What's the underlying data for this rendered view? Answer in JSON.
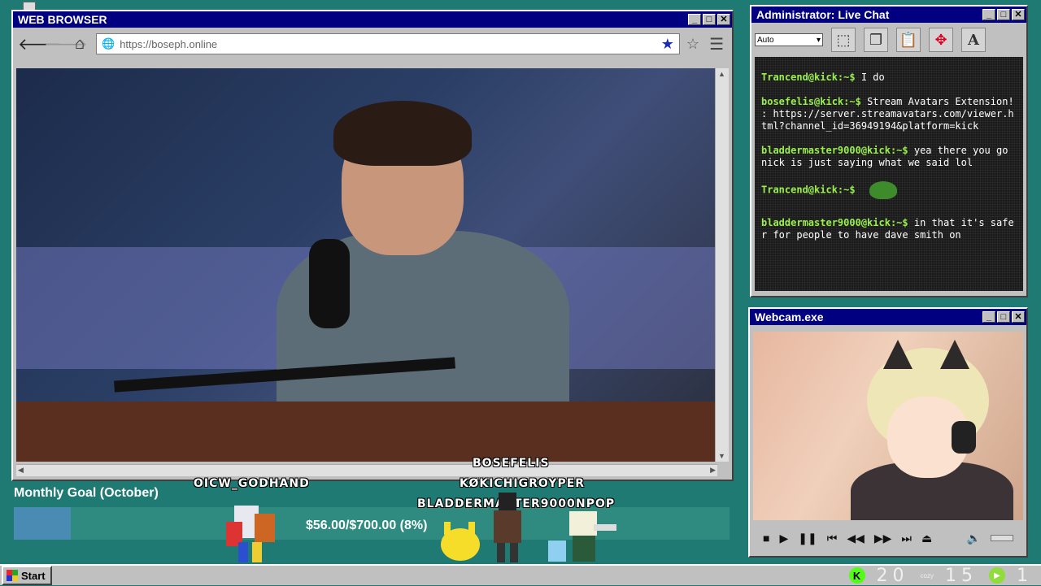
{
  "browser": {
    "title": "WEB BROWSER",
    "url": "https://boseph.online",
    "controls": {
      "minimize": "_",
      "maximize": "□",
      "close": "✕"
    }
  },
  "chat": {
    "title": "Administrator: Live Chat",
    "zoom": "Auto",
    "messages": [
      {
        "user": "Trancend@kick:~$",
        "text": "I do"
      },
      {
        "user": "bosefelis@kick:~$",
        "text": "Stream Avatars Extension! : https://server.streamavatars.com/viewer.html?channel_id=36949194&platform=kick"
      },
      {
        "user": "bladdermaster9000@kick:~$",
        "text": "yea there you go nick is just saying what we said lol"
      },
      {
        "user": "Trancend@kick:~$",
        "text": ""
      },
      {
        "user": "bladdermaster9000@kick:~$",
        "text": "in that it's safer for people to have dave smith on"
      }
    ]
  },
  "webcam": {
    "title": "Webcam.exe"
  },
  "goal": {
    "label": "Monthly Goal (October)",
    "text": "$56.00/$700.00 (8%)",
    "progress": 0.08
  },
  "overlay_names": {
    "n1": "OICW_GODHAND",
    "n2": "BOSEFELIS",
    "n3": "KØKICHIGROYPER",
    "n4": "BLADDERMASTER9000",
    "n5": "NPOP"
  },
  "taskbar": {
    "start": "Start",
    "tray_numbers": [
      "20",
      "15",
      "1"
    ],
    "tray_small": "cozy"
  },
  "colors": {
    "titlebar": "#000080",
    "desktop": "#1e7a72",
    "chat_user": "#9af04a",
    "kick_green": "#53fc18"
  }
}
